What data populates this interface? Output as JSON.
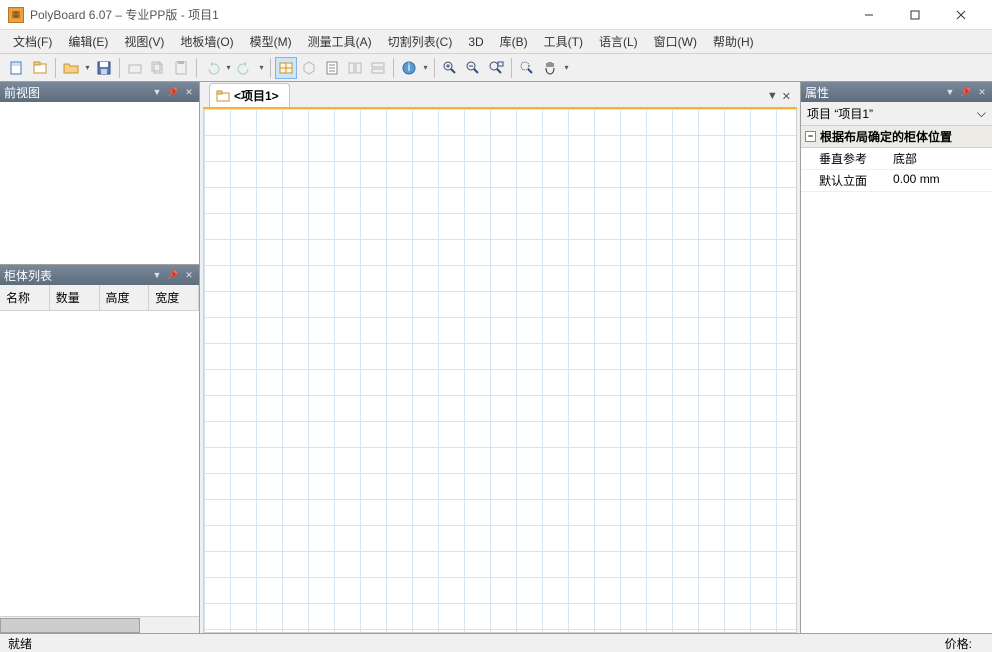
{
  "app": {
    "title": "PolyBoard 6.07 – 专业PP版 - 项目1"
  },
  "menu": {
    "file": "文档(F)",
    "edit": "编辑(E)",
    "view": "视图(V)",
    "floor": "地板墙(O)",
    "model": "模型(M)",
    "measure": "测量工具(A)",
    "cutlist": "切割列表(C)",
    "threeD": "3D",
    "library": "库(B)",
    "tools": "工具(T)",
    "language": "语言(L)",
    "window": "窗口(W)",
    "help": "帮助(H)"
  },
  "panels": {
    "frontview": {
      "title": "前视图"
    },
    "cabinetlist": {
      "title": "柜体列表",
      "cols": {
        "name": "名称",
        "qty": "数量",
        "height": "高度",
        "width": "宽度"
      }
    },
    "properties": {
      "title": "属性",
      "item_label": "项目 “项目1”",
      "group": "根据布局确定的柜体位置",
      "rows": {
        "vref": {
          "k": "垂直参考",
          "v": "底部"
        },
        "elev": {
          "k": "默认立面",
          "v": "0.00 mm"
        }
      }
    }
  },
  "tabs": {
    "project": "<项目1>"
  },
  "status": {
    "ready": "就绪",
    "price_label": "价格:"
  }
}
